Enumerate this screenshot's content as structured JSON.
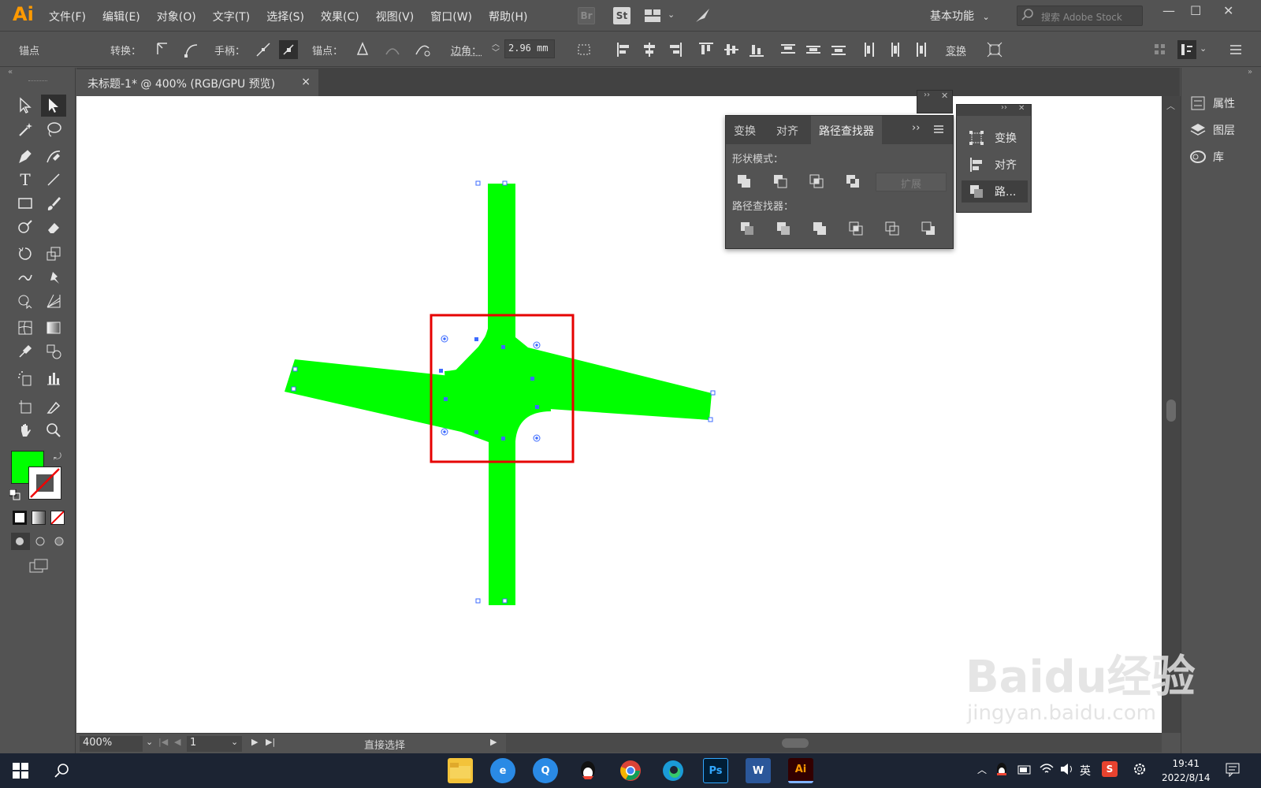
{
  "app": {
    "logo": "Ai"
  },
  "menu": [
    "文件(F)",
    "编辑(E)",
    "对象(O)",
    "文字(T)",
    "选择(S)",
    "效果(C)",
    "视图(V)",
    "窗口(W)",
    "帮助(H)"
  ],
  "topicons": {
    "br": "Br",
    "st": "St"
  },
  "workspace": "基本功能",
  "search_placeholder": "搜索 Adobe Stock",
  "control": {
    "anchor_label": "锚点",
    "convert_label": "转换：",
    "handle_label": "手柄：",
    "anchor2_label": "锚点：",
    "corner_label": "边角：",
    "corner_value": "2.96 mm",
    "transform_label": "变换"
  },
  "document_tab": {
    "title": "未标题-1* @ 400% (RGB/GPU 预览)",
    "close": "×"
  },
  "pathfinder": {
    "tabs": [
      "变换",
      "对齐",
      "路径查找器"
    ],
    "active_tab": "路径查找器",
    "shape_modes_label": "形状模式：",
    "pathfinders_label": "路径查找器：",
    "expand_label": "扩展",
    "more": "››"
  },
  "mini_panel": {
    "items": [
      "变换",
      "对齐",
      "路..."
    ]
  },
  "right_dock": {
    "items": [
      "属性",
      "图层",
      "库"
    ]
  },
  "status": {
    "zoom": "400%",
    "page": "1",
    "tool": "直接选择"
  },
  "artwork": {
    "fill_color": "#00ff00",
    "highlight_color": "#ff0000"
  },
  "taskbar": {
    "apps": [
      "file-explorer",
      "ie",
      "qq-browser",
      "qq",
      "chrome",
      "edge",
      "photoshop",
      "word",
      "illustrator"
    ],
    "ps_label": "Ps",
    "word_label": "W",
    "ai_label": "Ai",
    "ime": "英",
    "time": "19:41",
    "date": "2022/8/14"
  },
  "watermark": {
    "text": "Baidu经验",
    "url": "jingyan.baidu.com"
  },
  "colors": {
    "ui_bg": "#535353",
    "dark_bg": "#424242",
    "canvas": "#ffffff",
    "ai_orange": "#ff9a00",
    "taskbar": "#1c2433"
  }
}
